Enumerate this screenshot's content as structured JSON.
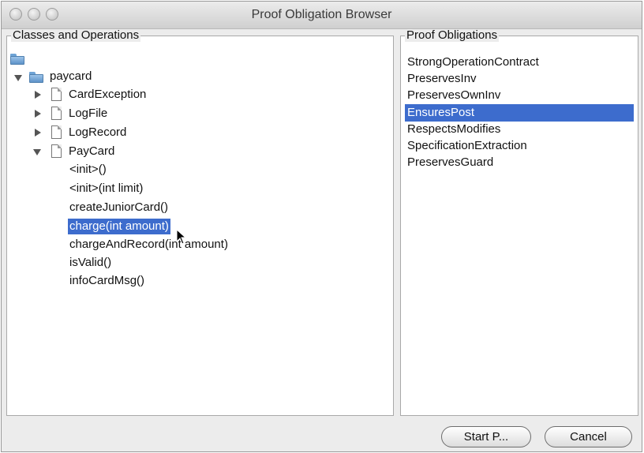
{
  "window": {
    "title": "Proof Obligation Browser"
  },
  "classes_panel": {
    "title": "Classes and Operations",
    "tree": {
      "package": "paycard",
      "classes": [
        "CardException",
        "LogFile",
        "LogRecord",
        "PayCard"
      ],
      "operations": [
        "<init>()",
        "<init>(int limit)",
        "createJuniorCard()",
        "charge(int amount)",
        "chargeAndRecord(int amount)",
        "isValid()",
        "infoCardMsg()"
      ],
      "selected_operation": "charge(int amount)"
    }
  },
  "obligations_panel": {
    "title": "Proof Obligations",
    "items": [
      "StrongOperationContract",
      "PreservesInv",
      "PreservesOwnInv",
      "EnsuresPost",
      "RespectsModifies",
      "SpecificationExtraction",
      "PreservesGuard"
    ],
    "selected": "EnsuresPost"
  },
  "buttons": {
    "start": "Start P...",
    "cancel": "Cancel"
  },
  "colors": {
    "selection": "#3d6ccd"
  }
}
